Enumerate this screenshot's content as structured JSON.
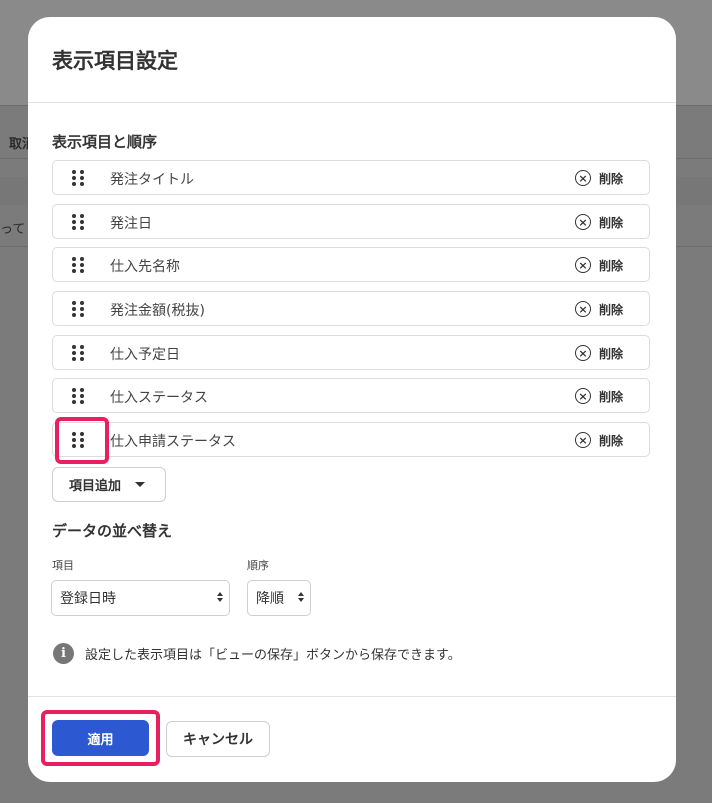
{
  "background": {
    "fragment_1": "取消",
    "fragment_2": "って（"
  },
  "modal": {
    "title": "表示項目設定",
    "section_items_title": "表示項目と順序",
    "delete_label": "削除",
    "items": [
      {
        "label": "発注タイトル"
      },
      {
        "label": "発注日"
      },
      {
        "label": "仕入先名称"
      },
      {
        "label": "発注金額(税抜)"
      },
      {
        "label": "仕入予定日"
      },
      {
        "label": "仕入ステータス"
      },
      {
        "label": "仕入申請ステータス"
      }
    ],
    "add_item_label": "項目追加",
    "sort_section_title": "データの並べ替え",
    "sort_field_label": "項目",
    "sort_field_value": "登録日時",
    "sort_order_label": "順序",
    "sort_order_value": "降順",
    "info_text": "設定した表示項目は「ビューの保存」ボタンから保存できます。",
    "apply_label": "適用",
    "cancel_label": "キャンセル"
  },
  "colors": {
    "overlay": "#7b7b7b",
    "primary": "#2c58d1",
    "highlight": "#e9205f"
  },
  "icons": {
    "drag": "drag-handle-icon",
    "delete": "close-circle-icon",
    "dropdown": "caret-down-icon",
    "info": "info-icon"
  }
}
